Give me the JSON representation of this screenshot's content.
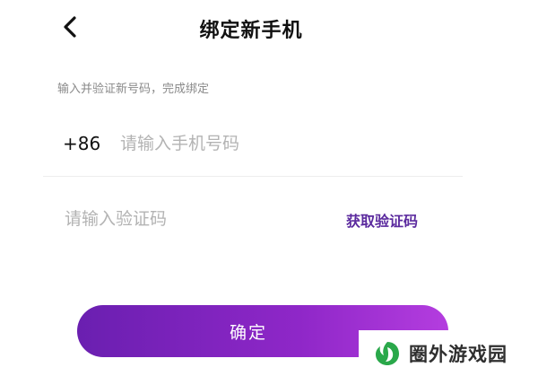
{
  "header": {
    "title": "绑定新手机",
    "back_icon": "chevron-left-icon"
  },
  "hint": "输入并验证新号码，完成绑定",
  "phone": {
    "country_code": "+86",
    "placeholder": "请输入手机号码",
    "value": ""
  },
  "code": {
    "placeholder": "请输入验证码",
    "value": "",
    "get_code_label": "获取验证码"
  },
  "confirm_label": "确定",
  "watermark": {
    "text": "圈外游戏园",
    "logo_icon": "leaf-logo-icon"
  },
  "colors": {
    "accent_start": "#6a1fb0",
    "accent_end": "#b43ddf",
    "link": "#5b2a9e",
    "watermark_green": "#2aa84a"
  }
}
